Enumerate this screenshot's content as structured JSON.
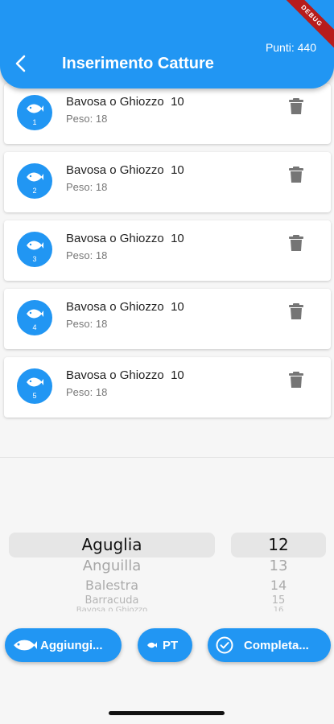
{
  "appbar": {
    "title": "Inserimento Catture",
    "points": "Punti: 440",
    "debug_label": "DEBUG"
  },
  "catches": [
    {
      "number": "1",
      "title": "Bavosa o Ghiozzo  10",
      "weight": "Peso: 18"
    },
    {
      "number": "2",
      "title": "Bavosa o Ghiozzo  10",
      "weight": "Peso: 18"
    },
    {
      "number": "3",
      "title": "Bavosa o Ghiozzo  10",
      "weight": "Peso: 18"
    },
    {
      "number": "4",
      "title": "Bavosa o Ghiozzo  10",
      "weight": "Peso: 18"
    },
    {
      "number": "5",
      "title": "Bavosa o Ghiozzo  10",
      "weight": "Peso: 18"
    }
  ],
  "species_picker": {
    "items": [
      "Aguglia",
      "Anguilla",
      "Balestra",
      "Barracuda",
      "Bavosa o Ghiozzo"
    ],
    "selected": "Aguglia"
  },
  "weight_picker": {
    "items": [
      "12",
      "13",
      "14",
      "15",
      "16"
    ],
    "selected": "12"
  },
  "buttons": {
    "add": "Aggiungi...",
    "pt": "PT",
    "complete": "Completa..."
  },
  "colors": {
    "primary": "#2196f3",
    "debug": "#b71c1c"
  },
  "icons": {
    "back": "back-arrow-icon",
    "avatar": "fish-icon",
    "delete": "trash-icon",
    "add": "fish-icon",
    "pt": "fish-icon",
    "complete": "check-circle-icon"
  }
}
